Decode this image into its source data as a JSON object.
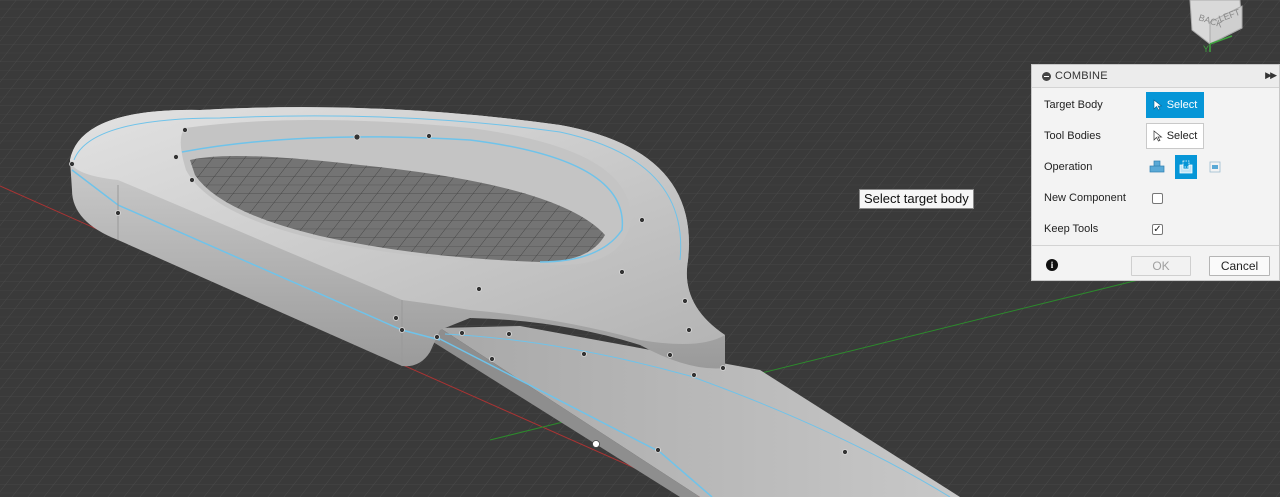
{
  "tooltip": {
    "text": "Select target body"
  },
  "viewcube": {
    "face_back": "BACK",
    "face_left": "LEFT",
    "axis_y": "Y"
  },
  "panel": {
    "title": "COMBINE",
    "rows": {
      "target_body": {
        "label": "Target Body",
        "button": "Select",
        "state": "active"
      },
      "tool_bodies": {
        "label": "Tool Bodies",
        "button": "Select",
        "state": "normal"
      },
      "operation": {
        "label": "Operation",
        "options": [
          "join-icon",
          "cut-icon",
          "intersect-icon"
        ],
        "selected_index": 1
      },
      "new_component": {
        "label": "New Component",
        "checked": false
      },
      "keep_tools": {
        "label": "Keep Tools",
        "checked": true
      }
    },
    "footer": {
      "ok": "OK",
      "cancel": "Cancel"
    }
  },
  "colors": {
    "background": "#3a3a3a",
    "accent": "#0696d7",
    "body": "#c9c9c9",
    "edge_highlight": "#6fc3ea"
  }
}
